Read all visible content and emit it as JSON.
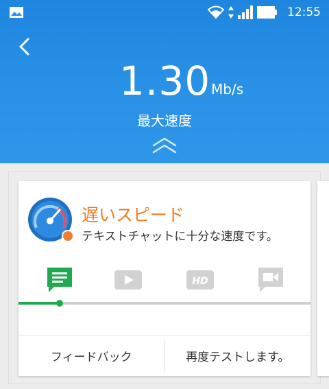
{
  "status_bar": {
    "time": "12:55",
    "icons": [
      "image-icon",
      "wifi-icon",
      "data-arrows-icon",
      "signal-icon",
      "battery-icon"
    ]
  },
  "header": {
    "speed_value": "1.30",
    "speed_unit": "Mb/s",
    "speed_label": "最大速度",
    "icons": [
      "back-arrow-icon",
      "expand-up-chevrons-icon"
    ]
  },
  "result_card": {
    "title": "遅いスピード",
    "description": "テキストチャットに十分な速度です。",
    "icon": "speedometer-gauge-icon",
    "use_cases": [
      {
        "icon": "chat-message-icon",
        "active": true
      },
      {
        "icon": "video-play-icon",
        "active": false
      },
      {
        "icon": "hd-video-icon",
        "active": false
      },
      {
        "icon": "video-call-icon",
        "active": false
      }
    ],
    "progress_fraction": 0.14,
    "feedback_label": "フィードバック",
    "retest_label": "再度テストします。"
  },
  "colors": {
    "header_blue": "#2a92e6",
    "result_orange": "#ef7d24",
    "active_green": "#1faa4f",
    "inactive_gray": "#cfcfcf"
  }
}
